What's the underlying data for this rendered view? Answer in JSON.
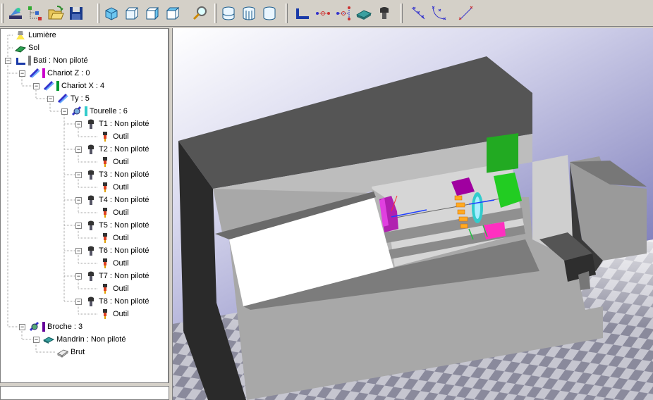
{
  "toolbar": {
    "groups": [
      [
        "new-scene-icon",
        "add-node-icon",
        "open-folder-icon",
        "save-icon"
      ],
      [
        "view-iso-icon",
        "view-front-icon",
        "view-side-icon",
        "view-top-icon",
        "zoom-icon"
      ],
      [
        "cylinder-icon",
        "cylinder-grid-icon",
        "cylinder-plain-icon"
      ],
      [
        "machine-frame-icon",
        "axis-link-icon",
        "axis-tree-icon",
        "chuck-icon",
        "tool-icon"
      ],
      [
        "path-points-icon",
        "arc-path-icon",
        "line-path-icon"
      ]
    ]
  },
  "tree": {
    "nodes": [
      {
        "label": "Lumière",
        "icon": "light-icon",
        "color": ""
      },
      {
        "label": "Sol",
        "icon": "floor-icon",
        "color": ""
      },
      {
        "label": "Bati : Non piloté",
        "icon": "machine-frame-icon",
        "color": "#808080"
      },
      {
        "label": "Chariot Z : 0",
        "icon": "slide-icon",
        "color": "#cc00cc"
      },
      {
        "label": "Chariot X : 4",
        "icon": "slide-icon",
        "color": "#009933"
      },
      {
        "label": "Ty : 5",
        "icon": "slide-icon",
        "color": ""
      },
      {
        "label": "Tourelle : 6",
        "icon": "turret-icon",
        "color": "#33cccc"
      },
      {
        "label": "T1 : Non piloté",
        "icon": "tool-holder-icon",
        "color": ""
      },
      {
        "label": "Outil",
        "icon": "tool-icon",
        "color": ""
      },
      {
        "label": "T2 : Non piloté",
        "icon": "tool-holder-icon",
        "color": ""
      },
      {
        "label": "Outil",
        "icon": "tool-icon",
        "color": ""
      },
      {
        "label": "T3 : Non piloté",
        "icon": "tool-holder-icon",
        "color": ""
      },
      {
        "label": "Outil",
        "icon": "tool-icon",
        "color": ""
      },
      {
        "label": "T4 : Non piloté",
        "icon": "tool-holder-icon",
        "color": ""
      },
      {
        "label": "Outil",
        "icon": "tool-icon",
        "color": ""
      },
      {
        "label": "T5 : Non piloté",
        "icon": "tool-holder-icon",
        "color": ""
      },
      {
        "label": "Outil",
        "icon": "tool-icon",
        "color": ""
      },
      {
        "label": "T6 : Non piloté",
        "icon": "tool-holder-icon",
        "color": ""
      },
      {
        "label": "Outil",
        "icon": "tool-icon",
        "color": ""
      },
      {
        "label": "T7 : Non piloté",
        "icon": "tool-holder-icon",
        "color": ""
      },
      {
        "label": "Outil",
        "icon": "tool-icon",
        "color": ""
      },
      {
        "label": "T8 : Non piloté",
        "icon": "tool-holder-icon",
        "color": ""
      },
      {
        "label": "Outil",
        "icon": "tool-icon",
        "color": ""
      },
      {
        "label": "Broche : 3",
        "icon": "spindle-icon",
        "color": "#660099"
      },
      {
        "label": "Mandrin : Non piloté",
        "icon": "chuck-icon",
        "color": ""
      },
      {
        "label": "Brut",
        "icon": "stock-icon",
        "color": ""
      }
    ]
  },
  "viewport": {
    "name": "3d-lathe-view",
    "background_top": "#ffffff",
    "background_bottom": "#7a7ab8",
    "floor_checker": [
      "#8c8c9e",
      "#c8c8d2"
    ]
  }
}
